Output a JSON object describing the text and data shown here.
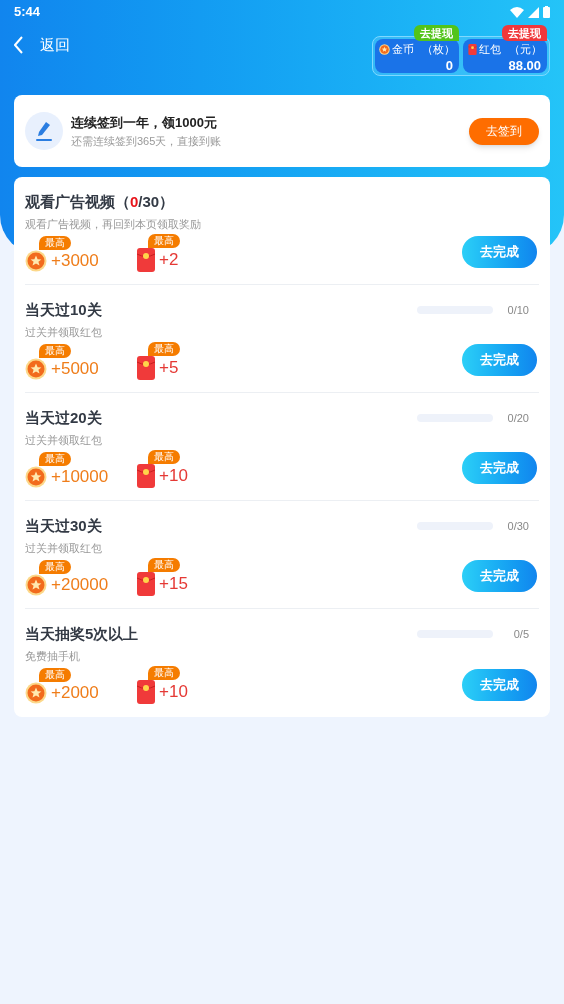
{
  "status_bar": {
    "time": "5:44"
  },
  "header": {
    "back_label": "返回"
  },
  "balances": [
    {
      "kind": "coin",
      "label": "金币",
      "unit": "（枚）",
      "value": "0",
      "badge": "去提现",
      "color": "#52c41a"
    },
    {
      "kind": "packet",
      "label": "红包",
      "unit": "（元）",
      "value": "88.00",
      "badge": "去提现",
      "color": "#f0383b"
    }
  ],
  "signin": {
    "title": "连续签到一年，领1000元",
    "subtitle": "还需连续签到365天，直接到账",
    "button": "去签到"
  },
  "tasks": [
    {
      "kind": "counter",
      "title_segments": [
        {
          "text": "观看广告视频（",
          "highlight": false
        },
        {
          "text": "0",
          "highlight": true
        },
        {
          "text": "/30）",
          "highlight": false
        }
      ],
      "subtitle": "观看广告视频，再回到本页领取奖励",
      "coin_badge": "最高",
      "coins": "+3000",
      "packet_badge": "最高",
      "packet": "+2",
      "button": "去完成"
    },
    {
      "kind": "progress",
      "title": "当天过10关",
      "level": 0,
      "reading": "0/10",
      "subtitle": "过关并领取红包",
      "coin_badge": "最高",
      "coins": "+5000",
      "packet_badge": "最高",
      "packet": "+5",
      "button": "去完成"
    },
    {
      "kind": "progress",
      "title": "当天过20关",
      "level": 0,
      "reading": "0/20",
      "subtitle": "过关并领取红包",
      "coin_badge": "最高",
      "coins": "+10000",
      "packet_badge": "最高",
      "packet": "+10",
      "button": "去完成"
    },
    {
      "kind": "progress",
      "title": "当天过30关",
      "level": 0,
      "reading": "0/30",
      "subtitle": "过关并领取红包",
      "coin_badge": "最高",
      "coins": "+20000",
      "packet_badge": "最高",
      "packet": "+15",
      "button": "去完成"
    },
    {
      "kind": "progress",
      "title": "当天抽奖5次以上",
      "level": 0,
      "reading": "0/5",
      "subtitle": "免费抽手机",
      "coin_badge": "最高",
      "coins": "+2000",
      "packet_badge": "最高",
      "packet": "+10",
      "button": "去完成"
    }
  ]
}
